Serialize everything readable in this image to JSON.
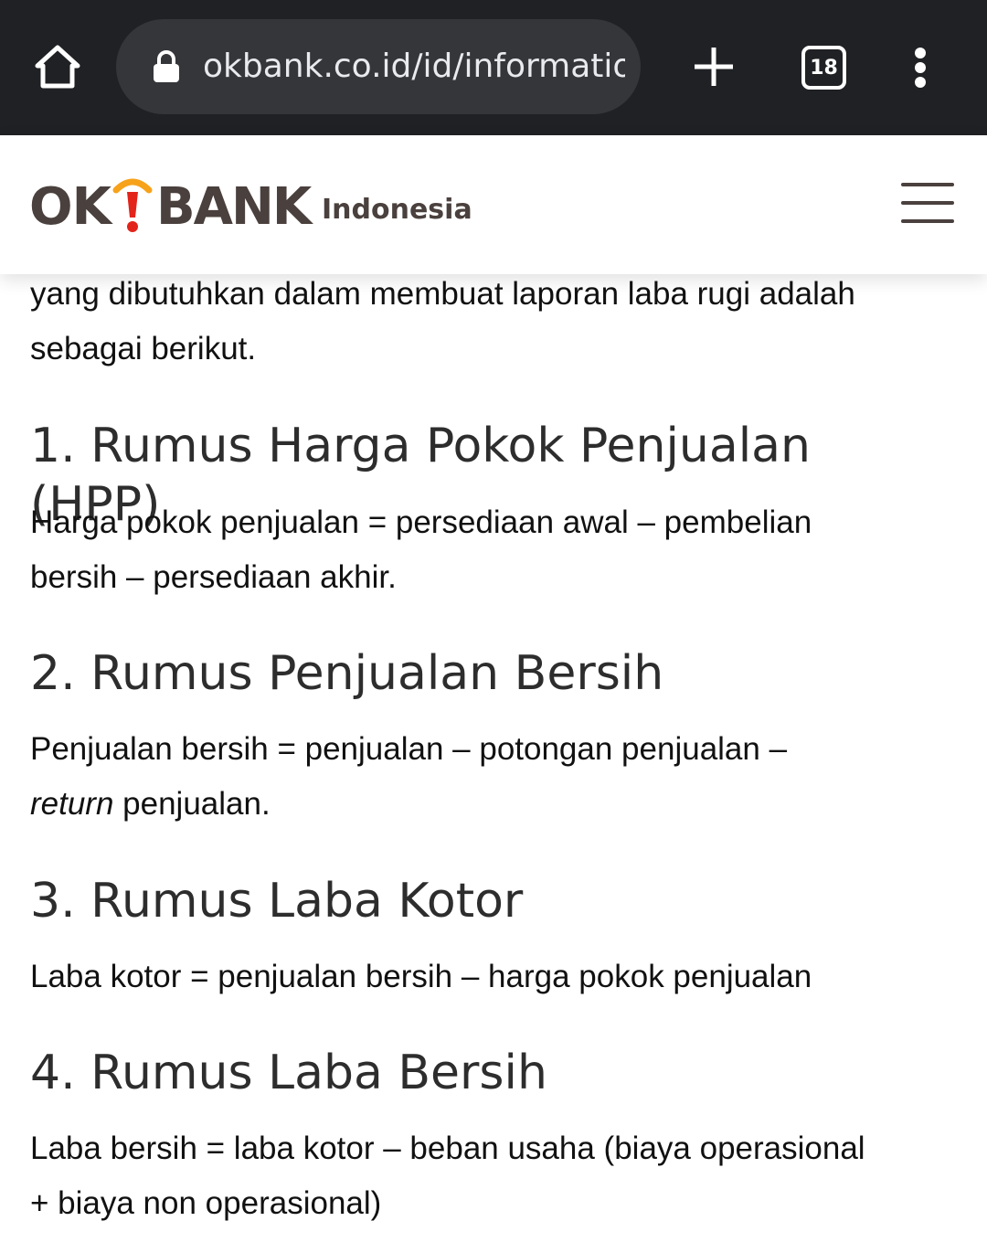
{
  "browser": {
    "url": "okbank.co.id/id/information",
    "tab_count": "18",
    "icons": [
      "home-icon",
      "lock-icon",
      "plus-icon",
      "tab-switcher-icon",
      "more-vert-icon"
    ]
  },
  "site": {
    "logo_ok": "OK",
    "logo_bank": "BANK",
    "logo_sub": "Indonesia",
    "logo_accent_color": "#f7a21b",
    "logo_exclaim_color": "#e2241b",
    "brand_text_color": "#4a403d"
  },
  "article": {
    "intro_line1": "yang dibutuhkan dalam membuat laporan laba rugi adalah",
    "intro_line2": "sebagai berikut.",
    "sections": [
      {
        "heading": "1. Rumus Harga Pokok Penjualan (HPP)",
        "line1": "Harga pokok penjualan = persediaan awal – pembelian",
        "line2": "bersih – persediaan akhir."
      },
      {
        "heading": "2. Rumus Penjualan Bersih",
        "line1": "Penjualan bersih = penjualan – potongan penjualan –",
        "line2_italic": "return",
        "line2_rest": " penjualan."
      },
      {
        "heading": "3. Rumus Laba Kotor",
        "line1": "Laba kotor = penjualan bersih – harga pokok penjualan"
      },
      {
        "heading": "4. Rumus Laba Bersih",
        "line1": "Laba bersih = laba kotor – beban usaha (biaya operasional",
        "line2": "+ biaya non operasional)"
      }
    ]
  }
}
